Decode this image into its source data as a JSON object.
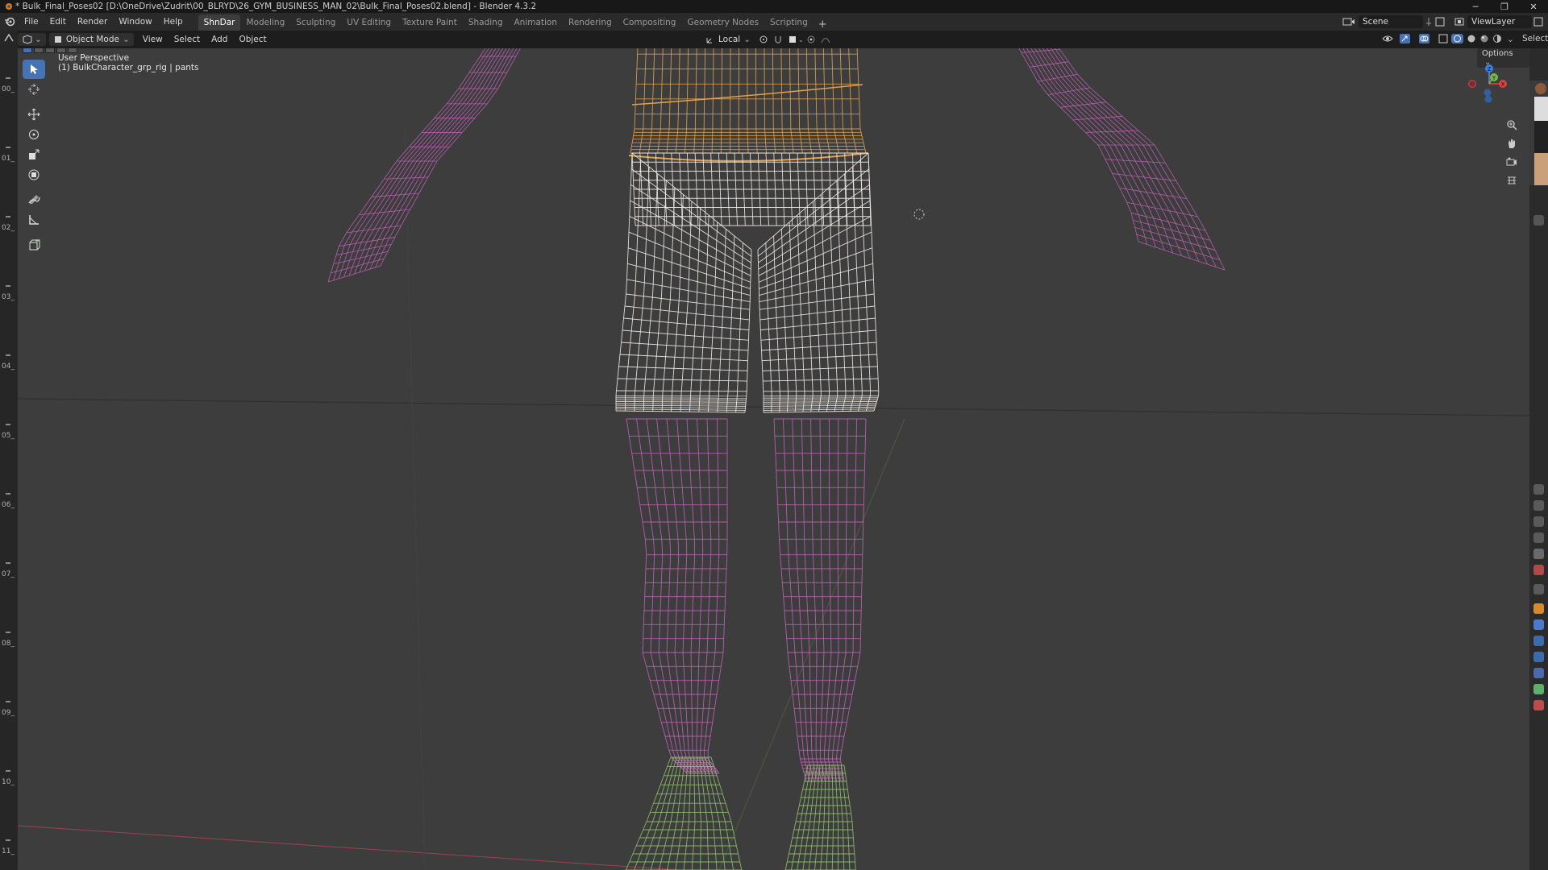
{
  "window": {
    "title": "* Bulk_Final_Poses02 [D:\\OneDrive\\Zudrit\\00_BLRYD\\26_GYM_BUSINESS_MAN_02\\Bulk_Final_Poses02.blend] - Blender 4.3.2",
    "minimize": "─",
    "restore": "❐",
    "close": "✕"
  },
  "menu": [
    "File",
    "Edit",
    "Render",
    "Window",
    "Help"
  ],
  "workspaces": [
    {
      "label": "ShnDar",
      "active": true
    },
    {
      "label": "Modeling",
      "active": false
    },
    {
      "label": "Sculpting",
      "active": false
    },
    {
      "label": "UV Editing",
      "active": false
    },
    {
      "label": "Texture Paint",
      "active": false
    },
    {
      "label": "Shading",
      "active": false
    },
    {
      "label": "Animation",
      "active": false
    },
    {
      "label": "Rendering",
      "active": false
    },
    {
      "label": "Compositing",
      "active": false
    },
    {
      "label": "Geometry Nodes",
      "active": false
    },
    {
      "label": "Scripting",
      "active": false
    }
  ],
  "workspace_add": "+",
  "scene_field": "Scene",
  "viewlayer_field": "ViewLayer",
  "viewport_header": {
    "mode": "Object Mode",
    "menus": [
      "View",
      "Select",
      "Add",
      "Object"
    ],
    "transform_orientation": "Local",
    "right_clipped_text": "Select"
  },
  "viewport": {
    "perspective_label": "User Perspective",
    "object_label": "(1) BulkCharacter_grp_rig | pants",
    "options_label": "Options"
  },
  "gizmo": {
    "z": "Z",
    "y": "Y",
    "x": "X"
  },
  "timeline_labels": [
    "00_",
    "01_",
    "02_",
    "03_",
    "04_",
    "05_",
    "06_",
    "07_",
    "08_",
    "09_",
    "10_",
    "11_"
  ],
  "colors": {
    "viewport_bg": "#3d3d3d",
    "wire_pants": "#f2ece6",
    "wire_shirt": "#e0a24e",
    "wire_body": "#c060b8",
    "wire_shoes": "#8ec06a",
    "axis_x": "#a04050",
    "accent": "#4772b3"
  }
}
